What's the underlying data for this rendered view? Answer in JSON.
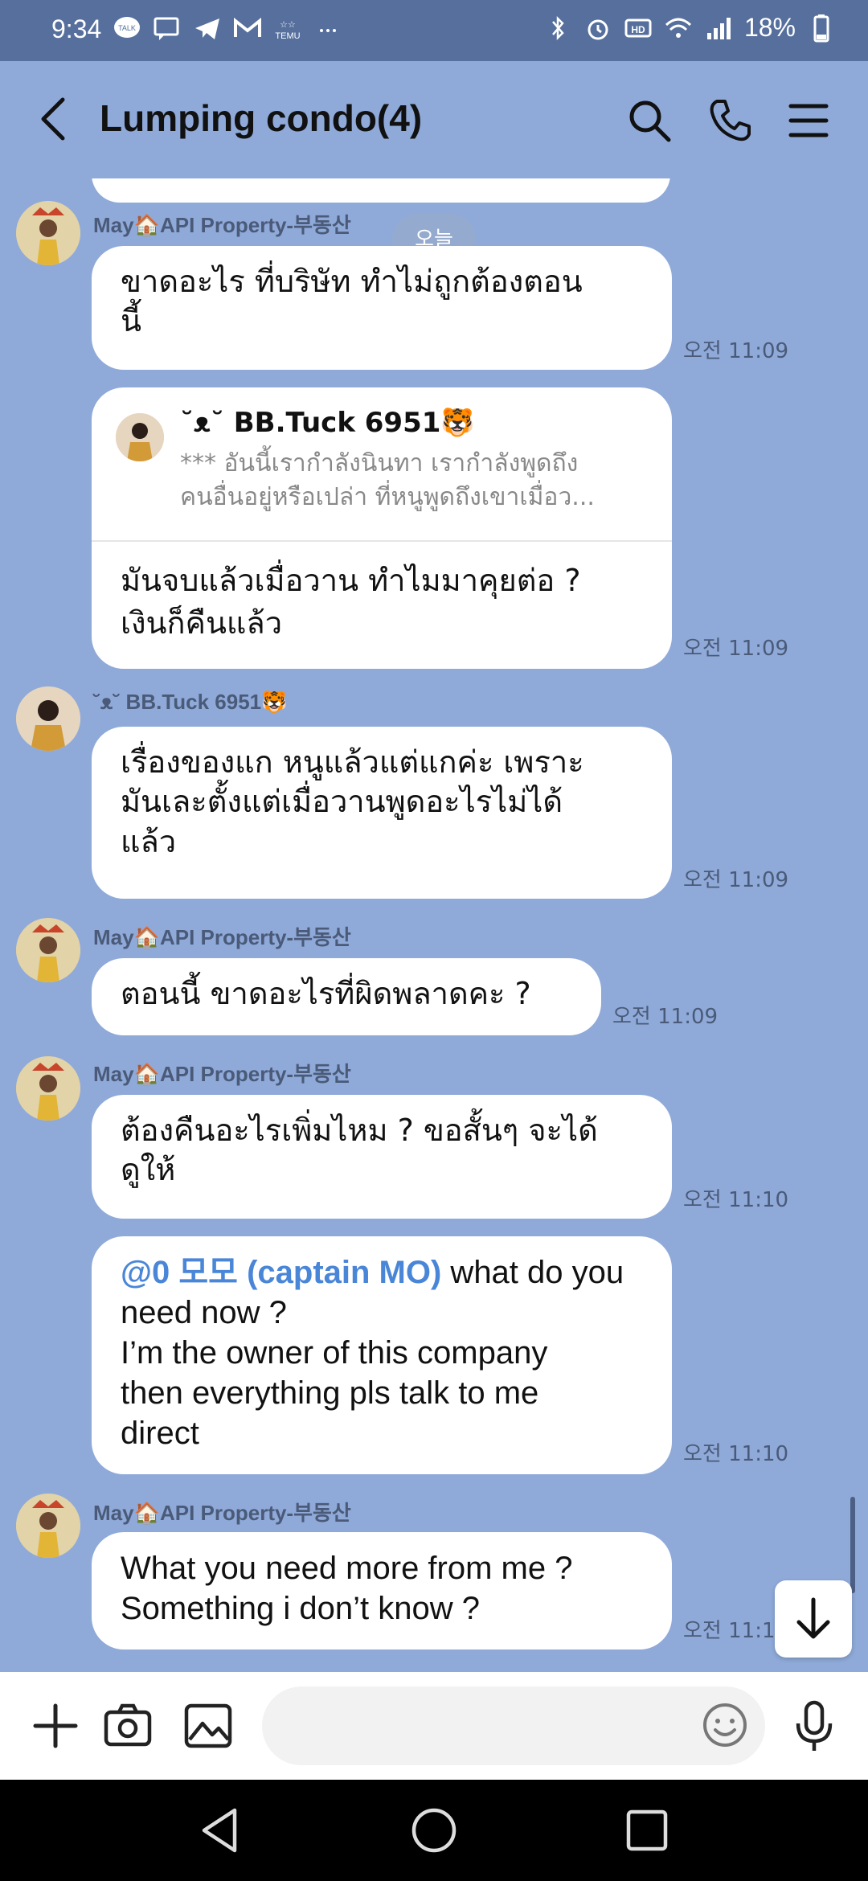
{
  "status_bar": {
    "time": "9:34",
    "battery": "18%",
    "left_icons": [
      "talk-icon",
      "message-icon",
      "telegram-icon",
      "gmail-icon",
      "temu-icon",
      "more-icon"
    ],
    "right_icons": [
      "bluetooth-icon",
      "alarm-icon",
      "hd-icon",
      "wifi-icon",
      "signal-icon",
      "battery-icon"
    ]
  },
  "header": {
    "title": "Lumping condo(4)",
    "actions": [
      "search-icon",
      "phone-icon",
      "menu-icon"
    ]
  },
  "chat": {
    "day_separator": "오늘",
    "messages": [
      {
        "sender": "May🏠API Property-부동산",
        "text_lines": [
          "ขาดอะไร ที่บริษัท ทำไม่ถูกต้องตอน",
          "นี้"
        ],
        "time": "오전 11:09"
      },
      {
        "reply": {
          "quoted_name": "˘ᴥ˘ BB.Tuck 6951🐯",
          "quoted_text_lines": [
            "*** อันนี้เรากำลังนินทา เรากำลังพูดถึง",
            "คนอื่นอยู่หรือเปล่า ที่หนูพูดถึงเขาเมื่อว..."
          ]
        },
        "text_lines": [
          "มันจบแล้วเมื่อวาน ทำไมมาคุยต่อ ?",
          "เงินก็คืนแล้ว"
        ],
        "time": "오전 11:09"
      },
      {
        "sender": "˘ᴥ˘ BB.Tuck 6951🐯",
        "text_lines": [
          "เรื่องของแก หนูแล้วแต่แกค่ะ เพราะ",
          "มันเละตั้งแต่เมื่อวานพูดอะไรไม่ได้",
          "แล้ว"
        ],
        "time": "오전 11:09"
      },
      {
        "sender": "May🏠API Property-부동산",
        "text_lines": [
          "ตอนนี้ ขาดอะไรที่ผิดพลาดคะ ?"
        ],
        "time": "오전 11:09"
      },
      {
        "sender": "May🏠API Property-부동산",
        "text_lines": [
          "ต้องคืนอะไรเพิ่มไหม ? ขอสั้นๆ จะได้",
          "ดูให้"
        ],
        "time": "오전 11:10"
      },
      {
        "mention": "@0 모모 (captain MO)",
        "text_lines": [
          " what do you",
          "need now ?",
          "I’m the owner of this company",
          "then everything pls talk to me",
          "direct"
        ],
        "time": "오전 11:10"
      },
      {
        "sender": "May🏠API Property-부동산",
        "text_lines": [
          "What you need more from me ?",
          "Something i don’t know ?"
        ],
        "time": "오전 11:11"
      }
    ]
  },
  "input_bar": {
    "placeholder": "",
    "icons": [
      "plus-icon",
      "camera-icon",
      "image-icon",
      "emoji-icon",
      "microphone-icon"
    ]
  },
  "nav_bar": {
    "buttons": [
      "back-triangle-icon",
      "home-circle-icon",
      "recents-square-icon"
    ]
  },
  "colors": {
    "chat_background": "#8faad9",
    "status_bar": "#566f9c",
    "bubble": "#ffffff",
    "mention": "#4a86d8"
  }
}
